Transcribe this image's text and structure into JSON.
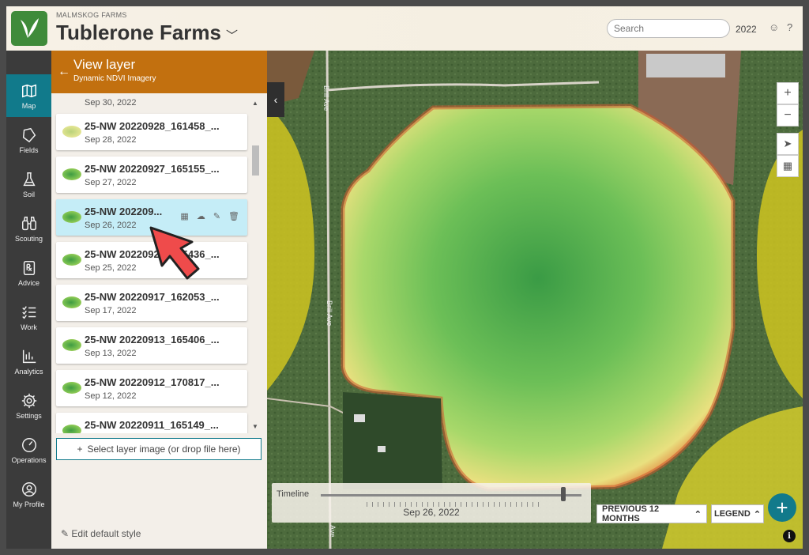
{
  "header": {
    "org_name": "MALMSKOG FARMS",
    "farm_name": "Tublerone Farms",
    "search_placeholder": "Search",
    "year": "2022"
  },
  "sidebar": {
    "items": [
      {
        "label": "Map",
        "icon": "map-icon",
        "active": true
      },
      {
        "label": "Fields",
        "icon": "fields-icon"
      },
      {
        "label": "Soil",
        "icon": "flask-icon"
      },
      {
        "label": "Scouting",
        "icon": "binoculars-icon"
      },
      {
        "label": "Advice",
        "icon": "prescription-icon"
      },
      {
        "label": "Work",
        "icon": "checklist-icon"
      },
      {
        "label": "Analytics",
        "icon": "chart-icon"
      },
      {
        "label": "Settings",
        "icon": "gear-icon"
      },
      {
        "label": "Operations",
        "icon": "gauge-icon"
      },
      {
        "label": "My Profile",
        "icon": "profile-icon"
      }
    ]
  },
  "panel": {
    "title": "View layer",
    "subtitle": "Dynamic NDVI Imagery",
    "cut_date": "Sep 30, 2022",
    "layers": [
      {
        "name": "25-NW 20220928_161458_...",
        "date": "Sep 28, 2022"
      },
      {
        "name": "25-NW 20220927_165155_...",
        "date": "Sep 27, 2022"
      },
      {
        "name": "25-NW 202209...",
        "date": "Sep 26, 2022",
        "selected": true
      },
      {
        "name": "25-NW 20220925_165436_...",
        "date": "Sep 25, 2022"
      },
      {
        "name": "25-NW 20220917_162053_...",
        "date": "Sep 17, 2022"
      },
      {
        "name": "25-NW 20220913_165406_...",
        "date": "Sep 13, 2022"
      },
      {
        "name": "25-NW 20220912_170817_...",
        "date": "Sep 12, 2022"
      },
      {
        "name": "25-NW 20220911_165149_...",
        "date": ""
      }
    ],
    "upload_label": "Select layer image (or drop file here)",
    "edit_style_label": "Edit default style"
  },
  "map": {
    "road_top": "Brill Ave",
    "road_mid": "Brill Ave",
    "road_bottom": "Ave",
    "timeline_label": "Timeline",
    "timeline_date": "Sep 26, 2022",
    "timeline_position": 0.93,
    "prev_label": "PREVIOUS 12 MONTHS",
    "legend_label": "LEGEND"
  }
}
